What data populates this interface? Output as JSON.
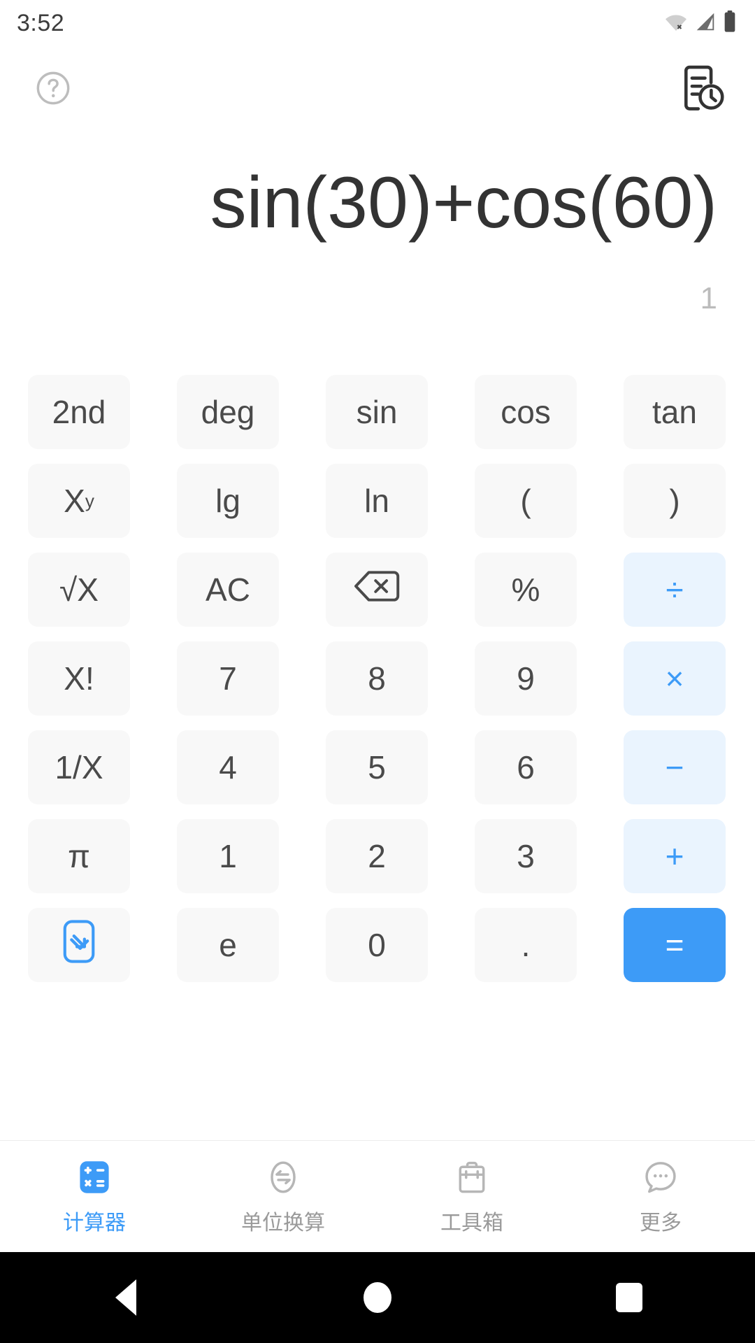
{
  "status_bar": {
    "time": "3:52",
    "icons": [
      "wifi-off-icon",
      "signal-icon",
      "battery-icon"
    ]
  },
  "top_bar": {
    "help_icon": "help-circle-icon",
    "history_icon": "history-document-icon"
  },
  "display": {
    "expression": "sin(30)+cos(60)",
    "result": "1"
  },
  "colors": {
    "accent": "#3d9bf7",
    "operator_bg": "#eaf4fe",
    "key_bg": "#f8f8f8",
    "text": "#4a4a4a",
    "expression_text": "#333333",
    "result_text": "#bcbcbc"
  },
  "keypad": {
    "rows": [
      [
        {
          "label": "2nd",
          "name": "key-second",
          "type": "fn"
        },
        {
          "label": "deg",
          "name": "key-deg",
          "type": "fn"
        },
        {
          "label": "sin",
          "name": "key-sin",
          "type": "fn"
        },
        {
          "label": "cos",
          "name": "key-cos",
          "type": "fn"
        },
        {
          "label": "tan",
          "name": "key-tan",
          "type": "fn"
        }
      ],
      [
        {
          "label": "X",
          "sup": "y",
          "name": "key-power",
          "type": "fn"
        },
        {
          "label": "lg",
          "name": "key-lg",
          "type": "fn"
        },
        {
          "label": "ln",
          "name": "key-ln",
          "type": "fn"
        },
        {
          "label": "(",
          "name": "key-open-paren",
          "type": "fn"
        },
        {
          "label": ")",
          "name": "key-close-paren",
          "type": "fn"
        }
      ],
      [
        {
          "label": "√X",
          "name": "key-sqrt",
          "type": "fn"
        },
        {
          "label": "AC",
          "name": "key-all-clear",
          "type": "fn"
        },
        {
          "label": "",
          "name": "key-backspace",
          "type": "icon",
          "icon": "backspace-icon"
        },
        {
          "label": "%",
          "name": "key-percent",
          "type": "fn"
        },
        {
          "label": "÷",
          "name": "key-divide",
          "type": "op"
        }
      ],
      [
        {
          "label": "X!",
          "name": "key-factorial",
          "type": "fn"
        },
        {
          "label": "7",
          "name": "key-7",
          "type": "num"
        },
        {
          "label": "8",
          "name": "key-8",
          "type": "num"
        },
        {
          "label": "9",
          "name": "key-9",
          "type": "num"
        },
        {
          "label": "×",
          "name": "key-multiply",
          "type": "op"
        }
      ],
      [
        {
          "label": "1/X",
          "name": "key-reciprocal",
          "type": "fn"
        },
        {
          "label": "4",
          "name": "key-4",
          "type": "num"
        },
        {
          "label": "5",
          "name": "key-5",
          "type": "num"
        },
        {
          "label": "6",
          "name": "key-6",
          "type": "num"
        },
        {
          "label": "−",
          "name": "key-minus",
          "type": "op"
        }
      ],
      [
        {
          "label": "π",
          "name": "key-pi",
          "type": "fn"
        },
        {
          "label": "1",
          "name": "key-1",
          "type": "num"
        },
        {
          "label": "2",
          "name": "key-2",
          "type": "num"
        },
        {
          "label": "3",
          "name": "key-3",
          "type": "num"
        },
        {
          "label": "+",
          "name": "key-plus",
          "type": "op"
        }
      ],
      [
        {
          "label": "",
          "name": "key-collapse",
          "type": "icon",
          "icon": "arrow-down-box-icon"
        },
        {
          "label": "e",
          "name": "key-e",
          "type": "fn"
        },
        {
          "label": "0",
          "name": "key-0",
          "type": "num"
        },
        {
          "label": ".",
          "name": "key-decimal",
          "type": "num"
        },
        {
          "label": "=",
          "name": "key-equals",
          "type": "equals"
        }
      ]
    ]
  },
  "bottom_nav": {
    "items": [
      {
        "label": "计算器",
        "name": "nav-calculator",
        "icon": "calculator-icon",
        "active": true
      },
      {
        "label": "单位换算",
        "name": "nav-unit-convert",
        "icon": "convert-icon",
        "active": false
      },
      {
        "label": "工具箱",
        "name": "nav-toolbox",
        "icon": "toolbox-icon",
        "active": false
      },
      {
        "label": "更多",
        "name": "nav-more",
        "icon": "more-dots-icon",
        "active": false
      }
    ]
  },
  "android_nav": {
    "back": "back-triangle-icon",
    "home": "home-circle-icon",
    "recents": "recents-square-icon"
  }
}
